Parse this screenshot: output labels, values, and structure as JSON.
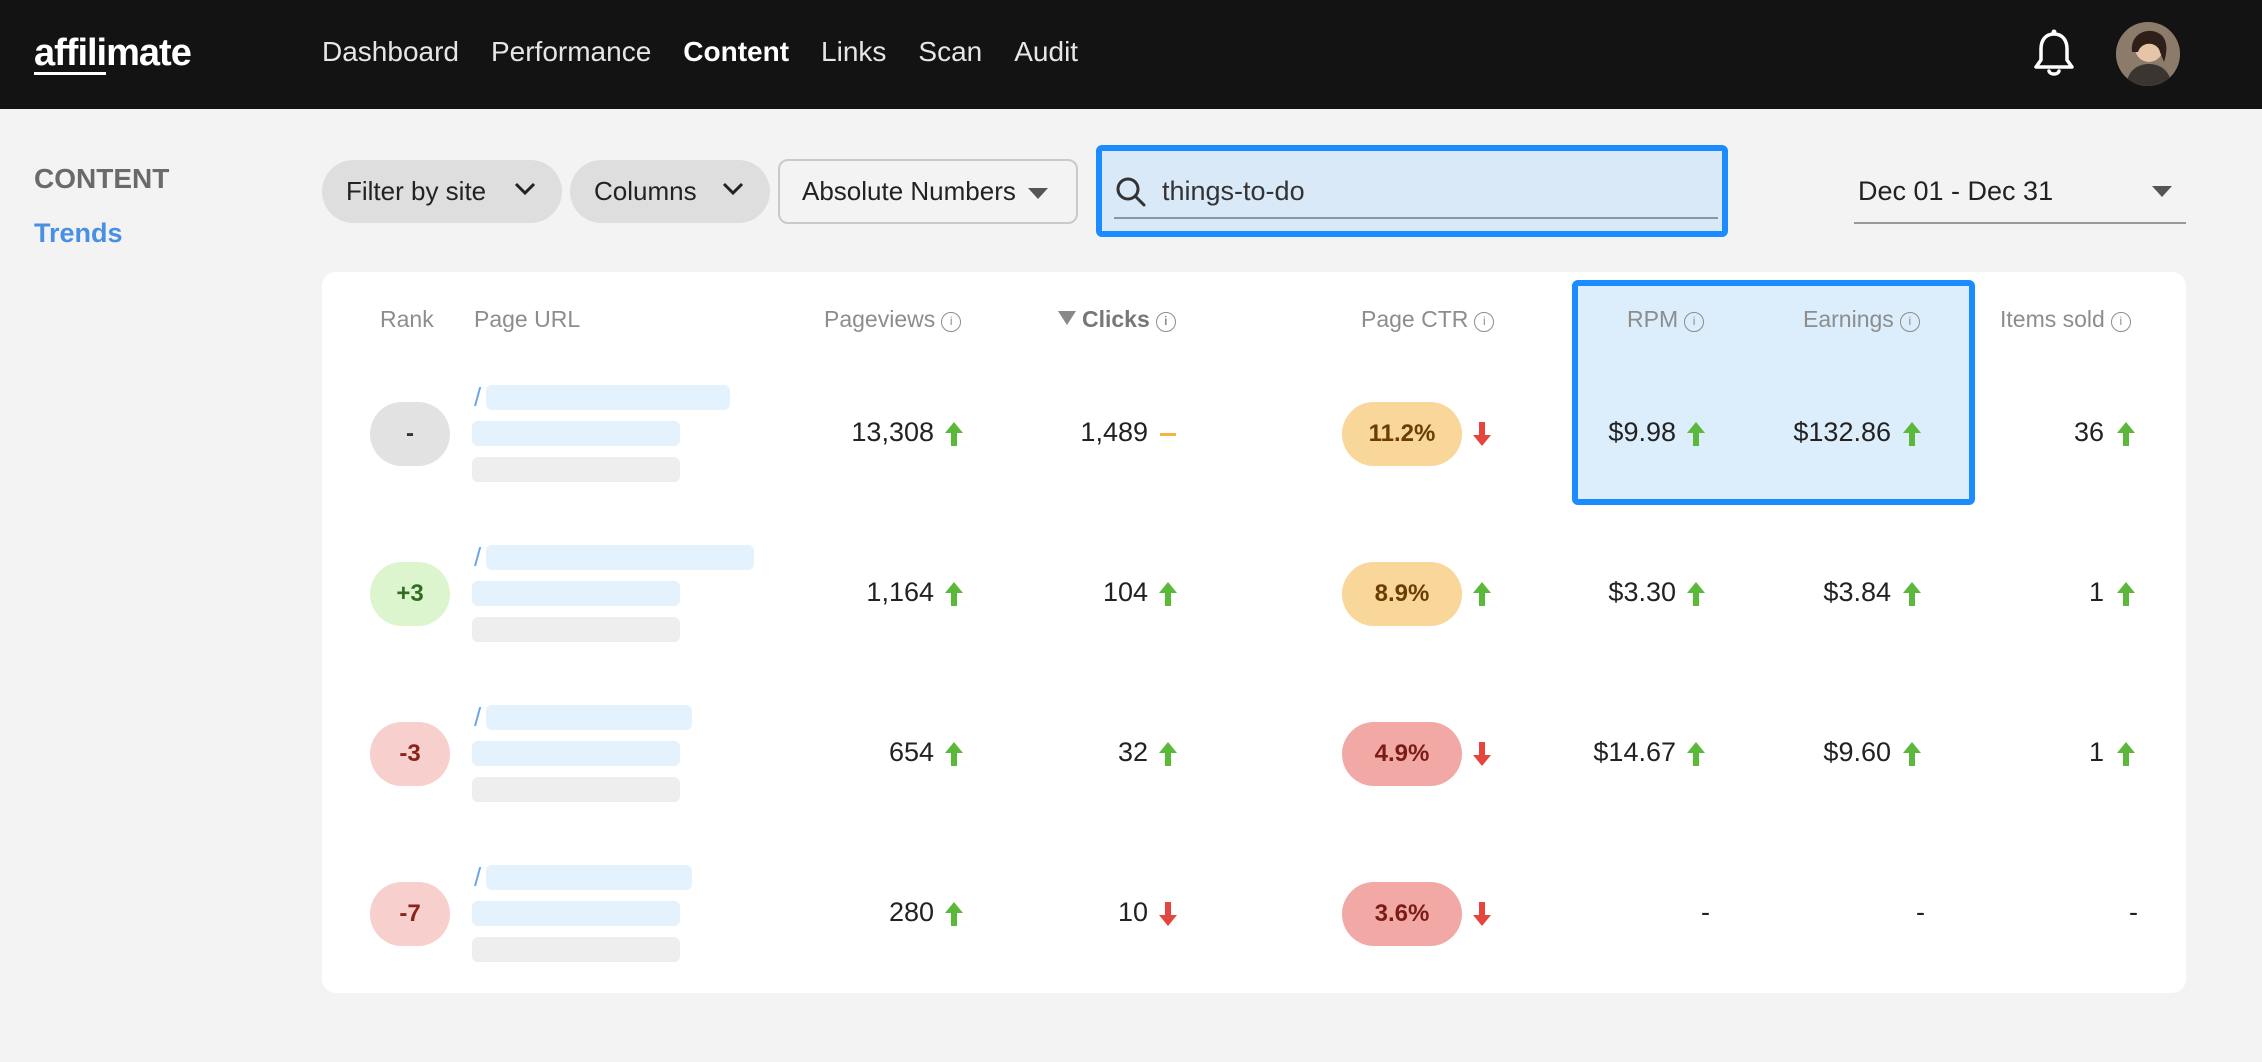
{
  "brand": {
    "logo": "affilimate"
  },
  "nav": {
    "items": [
      {
        "label": "Dashboard"
      },
      {
        "label": "Performance"
      },
      {
        "label": "Content"
      },
      {
        "label": "Links"
      },
      {
        "label": "Scan"
      },
      {
        "label": "Audit"
      }
    ],
    "active": "Content"
  },
  "sidebar": {
    "title": "CONTENT",
    "link": "Trends"
  },
  "filters": {
    "site": "Filter by site",
    "columns": "Columns",
    "mode": "Absolute Numbers",
    "search_value": "things-to-do",
    "date_range": "Dec 01 - Dec 31"
  },
  "table": {
    "headers": {
      "rank": "Rank",
      "url": "Page URL",
      "pageviews": "Pageviews",
      "clicks": "Clicks",
      "ctr": "Page CTR",
      "rpm": "RPM",
      "earnings": "Earnings",
      "items": "Items sold"
    },
    "sorted_column": "clicks",
    "rows": [
      {
        "rank": "-",
        "url_prefix": "/",
        "pageviews": "13,308",
        "pageviews_trend": "up",
        "clicks": "1,489",
        "clicks_trend": "flat",
        "ctr": "11.2%",
        "ctr_trend": "down",
        "rpm": "$9.98",
        "rpm_trend": "up",
        "earnings": "$132.86",
        "earnings_trend": "up",
        "items": "36",
        "items_trend": "up"
      },
      {
        "rank": "+3",
        "url_prefix": "/",
        "pageviews": "1,164",
        "pageviews_trend": "up",
        "clicks": "104",
        "clicks_trend": "up",
        "ctr": "8.9%",
        "ctr_trend": "up",
        "rpm": "$3.30",
        "rpm_trend": "up",
        "earnings": "$3.84",
        "earnings_trend": "up",
        "items": "1",
        "items_trend": "up"
      },
      {
        "rank": "-3",
        "url_prefix": "/",
        "pageviews": "654",
        "pageviews_trend": "up",
        "clicks": "32",
        "clicks_trend": "up",
        "ctr": "4.9%",
        "ctr_trend": "down",
        "rpm": "$14.67",
        "rpm_trend": "up",
        "earnings": "$9.60",
        "earnings_trend": "up",
        "items": "1",
        "items_trend": "up"
      },
      {
        "rank": "-7",
        "url_prefix": "/",
        "pageviews": "280",
        "pageviews_trend": "up",
        "clicks": "10",
        "clicks_trend": "down",
        "ctr": "3.6%",
        "ctr_trend": "down",
        "rpm": "-",
        "earnings": "-",
        "items": "-"
      }
    ]
  },
  "colors": {
    "accent": "#4a90e2",
    "highlight": "#1a8cff",
    "up": "#5cb83a",
    "down": "#e5453c",
    "flat": "#f2b544"
  },
  "icons": {
    "bell": "bell-icon",
    "search": "search-icon",
    "info": "info-icon",
    "up": "arrow-up-icon",
    "down": "arrow-down-icon"
  }
}
